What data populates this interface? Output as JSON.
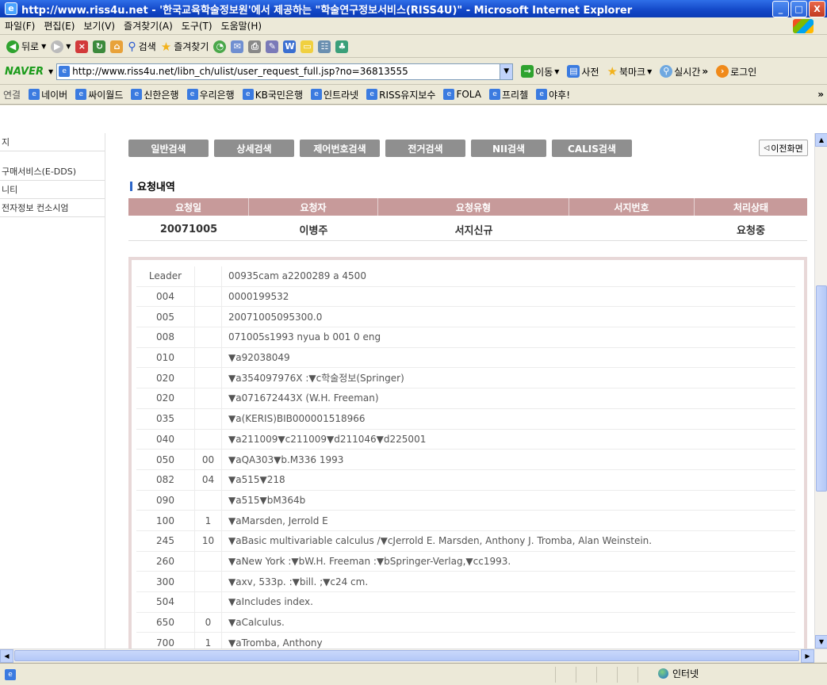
{
  "window": {
    "title": "http://www.riss4u.net - '한국교육학술정보원'에서 제공하는 \"학술연구정보서비스(RISS4U)\" - Microsoft Internet Explorer"
  },
  "menu": [
    "파일(F)",
    "편집(E)",
    "보기(V)",
    "즐겨찾기(A)",
    "도구(T)",
    "도움말(H)"
  ],
  "toolbar": {
    "back": "뒤로",
    "search": "검색",
    "favorites": "즐겨찾기"
  },
  "naverbar": {
    "brand": "NAVER",
    "address": "http://www.riss4u.net/libn_ch/ulist/user_request_full.jsp?no=36813555",
    "go": "이동",
    "dict": "사전",
    "bookmark": "북마크",
    "realtime": "실시간",
    "login": "로그인"
  },
  "links": {
    "label": "연결",
    "items": [
      "네이버",
      "싸이월드",
      "신한은행",
      "우리은행",
      "KB국민은행",
      "인트라넷",
      "RISS유지보수",
      "FOLA",
      "프리첼",
      "야후!"
    ]
  },
  "leftnav": [
    "지",
    "구매서비스(E-DDS)",
    "니티",
    "전자정보 컨소시엄"
  ],
  "tabs": [
    "일반검색",
    "상세검색",
    "제어번호검색",
    "전거검색",
    "NII검색",
    "CALIS검색"
  ],
  "prev_button": "이전화면",
  "section_title": "요청내역",
  "request_table": {
    "headers": [
      "요청일",
      "요청자",
      "요청유형",
      "서지번호",
      "처리상태"
    ],
    "row": [
      "20071005",
      "이병주",
      "서지신규",
      "",
      "요청중"
    ]
  },
  "marc": [
    {
      "tag": "Leader",
      "ind": "",
      "value": "00935cam a2200289 a 4500"
    },
    {
      "tag": "004",
      "ind": "",
      "value": "0000199532"
    },
    {
      "tag": "005",
      "ind": "",
      "value": "20071005095300.0"
    },
    {
      "tag": "008",
      "ind": "",
      "value": "071005s1993 nyua b 001 0 eng"
    },
    {
      "tag": "010",
      "ind": "",
      "value": "▼a92038049"
    },
    {
      "tag": "020",
      "ind": "",
      "value": "▼a354097976X :▼c학술정보(Springer)"
    },
    {
      "tag": "020",
      "ind": "",
      "value": "▼a071672443X (W.H. Freeman)"
    },
    {
      "tag": "035",
      "ind": "",
      "value": "▼a(KERIS)BIB000001518966"
    },
    {
      "tag": "040",
      "ind": "",
      "value": "▼a211009▼c211009▼d211046▼d225001"
    },
    {
      "tag": "050",
      "ind": "00",
      "value": "▼aQA303▼b.M336 1993"
    },
    {
      "tag": "082",
      "ind": "04",
      "value": "▼a515▼218"
    },
    {
      "tag": "090",
      "ind": "",
      "value": "▼a515▼bM364b"
    },
    {
      "tag": "100",
      "ind": "1",
      "value": "▼aMarsden, Jerrold E"
    },
    {
      "tag": "245",
      "ind": "10",
      "value": "▼aBasic multivariable calculus /▼cJerrold E. Marsden, Anthony J. Tromba, Alan Weinstein."
    },
    {
      "tag": "260",
      "ind": "",
      "value": "▼aNew York :▼bW.H. Freeman :▼bSpringer-Verlag,▼cc1993."
    },
    {
      "tag": "300",
      "ind": "",
      "value": "▼axv, 533p. :▼bill. ;▼c24 cm."
    },
    {
      "tag": "504",
      "ind": "",
      "value": "▼aIncludes index."
    },
    {
      "tag": "650",
      "ind": "0",
      "value": "▼aCalculus."
    },
    {
      "tag": "700",
      "ind": "1",
      "value": "▼aTromba, Anthony"
    }
  ],
  "status": {
    "zone": "인터넷"
  }
}
